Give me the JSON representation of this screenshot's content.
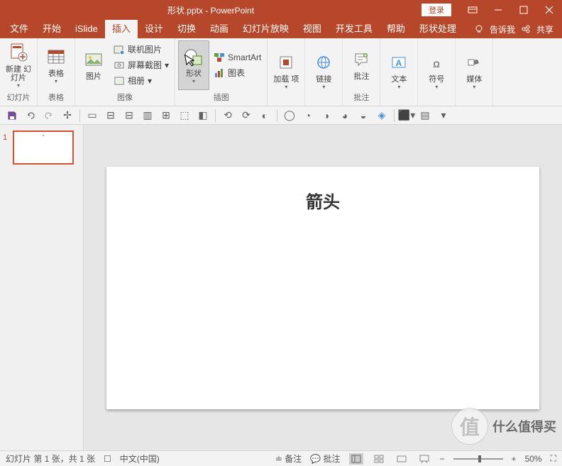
{
  "title": {
    "filename": "形状.pptx",
    "app": "PowerPoint",
    "separator": " - "
  },
  "login": "登录",
  "tabs": [
    "文件",
    "开始",
    "iSlide",
    "插入",
    "设计",
    "切换",
    "动画",
    "幻灯片放映",
    "视图",
    "开发工具",
    "帮助",
    "形状处理"
  ],
  "active_tab": "插入",
  "tell_me": "告诉我",
  "share": "共享",
  "ribbon": {
    "groups": {
      "slides": {
        "label": "幻灯片",
        "new_slide": "新建\n幻灯片"
      },
      "tables": {
        "label": "表格",
        "table": "表格"
      },
      "images": {
        "label": "图像",
        "picture": "图片",
        "online_pic": "联机图片",
        "screenshot": "屏幕截图",
        "album": "相册"
      },
      "illustrations": {
        "label": "插图",
        "shapes": "形状",
        "smartart": "SmartArt",
        "chart": "图表"
      },
      "addins": {
        "label": "",
        "addin": "加载\n项"
      },
      "links": {
        "label": "",
        "link": "链接"
      },
      "comments": {
        "label": "批注",
        "comment": "批注"
      },
      "text": {
        "label": "",
        "textbox": "文本"
      },
      "symbols": {
        "label": "",
        "symbol": "符号"
      },
      "media": {
        "label": "",
        "media": "媒体"
      }
    }
  },
  "thumb": {
    "num": "1"
  },
  "slide": {
    "title": "箭头"
  },
  "status": {
    "slide_info": "幻灯片 第 1 张，共 1 张",
    "lang": "中文(中国)",
    "notes": "备注",
    "comments": "批注",
    "zoom": "50%"
  },
  "watermark": {
    "icon": "值",
    "text": "什么值得买"
  }
}
